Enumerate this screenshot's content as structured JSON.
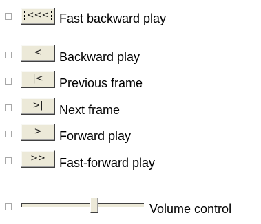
{
  "controls": [
    {
      "glyph": "<<<",
      "label": "Fast backward play"
    },
    {
      "glyph": "<",
      "label": "Backward play"
    },
    {
      "glyph": "|<",
      "label": "Previous frame"
    },
    {
      "glyph": ">|",
      "label": "Next frame"
    },
    {
      "glyph": ">",
      "label": "Forward play"
    },
    {
      "glyph": ">>",
      "label": "Fast-forward play"
    }
  ],
  "volume": {
    "label": "Volume control",
    "level": 0.6
  }
}
